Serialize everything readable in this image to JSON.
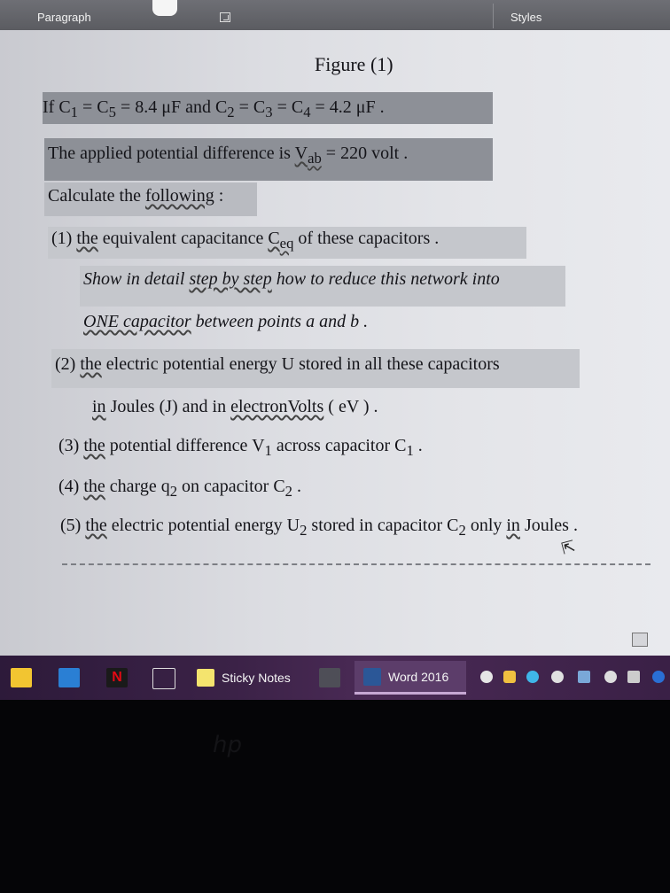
{
  "ribbon": {
    "paragraph_label": "Paragraph",
    "styles_label": "Styles"
  },
  "document": {
    "figure_title": "Figure (1)",
    "line1": {
      "a": "If  C",
      "sub1": "1",
      "b": " = C",
      "sub5": "5",
      "c": " =  8.4  μF  and  C",
      "sub2": "2",
      "d": " = C",
      "sub3": "3",
      "e": " = C",
      "sub4": "4",
      "f": " = 4.2  μF  ."
    },
    "line2": {
      "a": "The applied potential difference is  ",
      "vab": "V",
      "vab_sub": "ab",
      "b": " =  220  volt ."
    },
    "line3": {
      "a": "Calculate the ",
      "b": "following",
      "c": " :"
    },
    "item1": {
      "num": "(1) ",
      "the": "the",
      "a": " equivalent capacitance  ",
      "ceq": "C",
      "ceq_sub": "eq",
      "b": "  of these capacitors  ."
    },
    "item1_detail1": {
      "a": "Show in detail ",
      "b": "step by step",
      "c": " how to reduce this network into"
    },
    "item1_detail2": {
      "a": "ONE  capacitor",
      "b": " between points  a  and  b ."
    },
    "item2": {
      "num": "(2)  ",
      "the": "the",
      "a": " electric potential energy  U  stored in all these capacitors"
    },
    "item2_detail": {
      "a": "in",
      "b": " Joules (J)  and in  ",
      "c": "electronVolts",
      "d": " ( eV )  ."
    },
    "item3": {
      "num": "(3) ",
      "the": "the",
      "a": " potential difference  V",
      "sub": "1",
      "b": "  across capacitor  C",
      "sub2": "1",
      "c": "   ."
    },
    "item4": {
      "num": "(4) ",
      "the": "the",
      "a": " charge q",
      "sub": "2",
      "b": "  on capacitor  C",
      "sub2": "2",
      "c": "  ."
    },
    "item5": {
      "num": "(5) ",
      "the": "the",
      "a": " electric potential energy U",
      "sub": "2",
      "b": " stored in capacitor C",
      "sub2": "2",
      "c": " only ",
      "in": "in",
      "d": " Joules  ."
    }
  },
  "taskbar": {
    "sticky_notes": "Sticky Notes",
    "word": "Word 2016"
  },
  "brand": "hp",
  "colors": {
    "highlight_dark": "#8d9097",
    "highlight_light": "#b9bbc1",
    "taskbar": "#3b2247",
    "word_blue": "#2b5797"
  }
}
